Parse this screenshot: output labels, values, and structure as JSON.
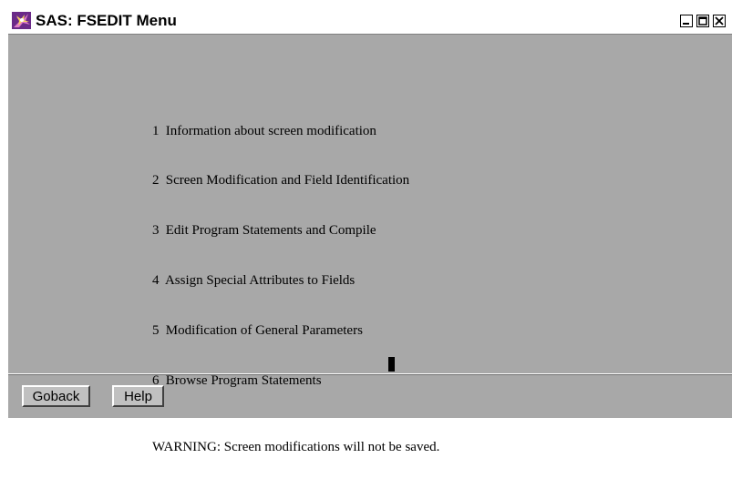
{
  "window": {
    "title": "SAS: FSEDIT Menu",
    "icon": "sas-app-icon",
    "controls": [
      "minimize-icon",
      "maximize-icon",
      "close-icon"
    ]
  },
  "menu": {
    "items": [
      {
        "number": "1",
        "label": "Information about screen modification"
      },
      {
        "number": "2",
        "label": "Screen Modification and Field Identification"
      },
      {
        "number": "3",
        "label": "Edit Program Statements and Compile"
      },
      {
        "number": "4",
        "label": "Assign Special Attributes to Fields"
      },
      {
        "number": "5",
        "label": "Modification of General Parameters"
      },
      {
        "number": "6",
        "label": "Browse Program Statements"
      }
    ],
    "warning": "WARNING: Screen modifications will not be saved."
  },
  "buttons": {
    "goback_label": "Goback",
    "help_label": "Help"
  },
  "colors": {
    "background": "#a8a8a8",
    "titlebar": "#ffffff",
    "button": "#c0c0c0"
  }
}
